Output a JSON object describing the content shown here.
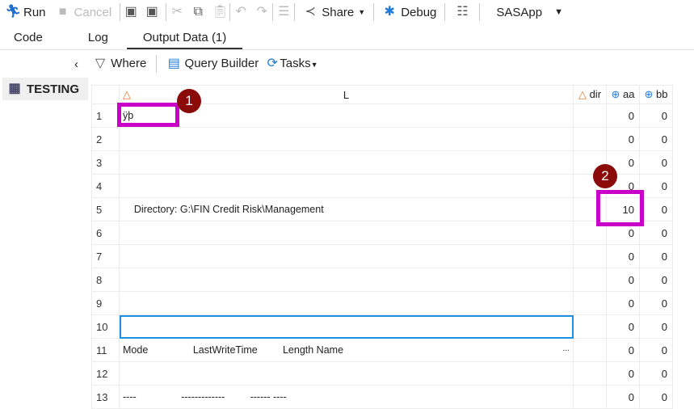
{
  "toolbar": {
    "run": "Run",
    "cancel": "Cancel",
    "share": "Share",
    "debug": "Debug",
    "server": "SASApp"
  },
  "tabs": [
    "Code",
    "Log",
    "Output Data (1)"
  ],
  "subtoolbar": {
    "where": "Where",
    "query_builder": "Query Builder",
    "tasks": "Tasks"
  },
  "sidebar": {
    "dataset": "TESTING"
  },
  "columns": {
    "L": "L",
    "dir": "dir",
    "aa": "aa",
    "bb": "bb"
  },
  "rows": [
    {
      "n": "1",
      "L": "ÿþ",
      "aa": "0",
      "bb": "0"
    },
    {
      "n": "2",
      "L": "",
      "aa": "0",
      "bb": "0"
    },
    {
      "n": "3",
      "L": "",
      "aa": "0",
      "bb": "0"
    },
    {
      "n": "4",
      "L": "",
      "aa": "0",
      "bb": "0"
    },
    {
      "n": "5",
      "L": "    Directory: G:\\FIN Credit Risk\\Management",
      "aa": "10",
      "bb": "0"
    },
    {
      "n": "6",
      "L": "",
      "aa": "0",
      "bb": "0"
    },
    {
      "n": "7",
      "L": "",
      "aa": "0",
      "bb": "0"
    },
    {
      "n": "8",
      "L": "",
      "aa": "0",
      "bb": "0"
    },
    {
      "n": "9",
      "L": "",
      "aa": "0",
      "bb": "0"
    },
    {
      "n": "10",
      "L": "",
      "aa": "0",
      "bb": "0"
    },
    {
      "n": "11",
      "L": "Mode                LastWriteTime         Length Name",
      "aa": "0",
      "bb": "0",
      "ellipsis": "..."
    },
    {
      "n": "12",
      "L": "",
      "aa": "0",
      "bb": "0"
    },
    {
      "n": "13",
      "L": "----                -------------         ------ ----",
      "aa": "0",
      "bb": "0"
    }
  ],
  "annotations": [
    "1",
    "2"
  ],
  "colors": {
    "highlight": "#c800c8",
    "badge": "#8b0a0a",
    "selection": "#1e90e0"
  }
}
